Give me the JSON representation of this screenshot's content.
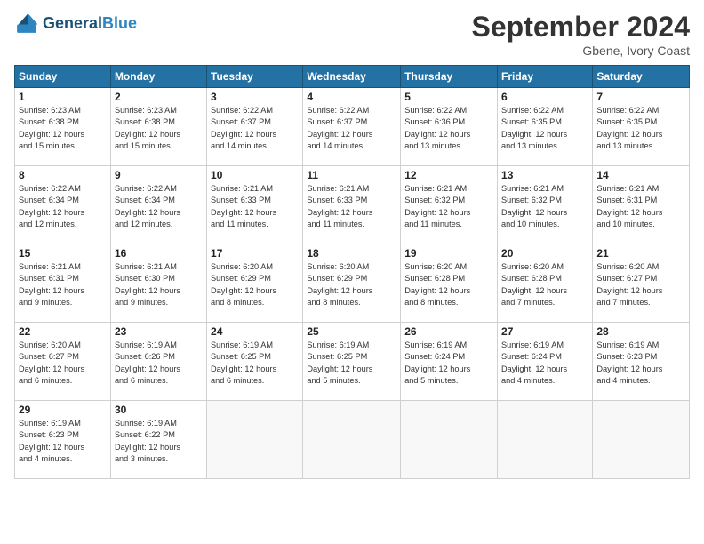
{
  "header": {
    "logo_general": "General",
    "logo_blue": "Blue",
    "month_title": "September 2024",
    "location": "Gbene, Ivory Coast"
  },
  "weekdays": [
    "Sunday",
    "Monday",
    "Tuesday",
    "Wednesday",
    "Thursday",
    "Friday",
    "Saturday"
  ],
  "weeks": [
    [
      {
        "day": "1",
        "info": "Sunrise: 6:23 AM\nSunset: 6:38 PM\nDaylight: 12 hours\nand 15 minutes."
      },
      {
        "day": "2",
        "info": "Sunrise: 6:23 AM\nSunset: 6:38 PM\nDaylight: 12 hours\nand 15 minutes."
      },
      {
        "day": "3",
        "info": "Sunrise: 6:22 AM\nSunset: 6:37 PM\nDaylight: 12 hours\nand 14 minutes."
      },
      {
        "day": "4",
        "info": "Sunrise: 6:22 AM\nSunset: 6:37 PM\nDaylight: 12 hours\nand 14 minutes."
      },
      {
        "day": "5",
        "info": "Sunrise: 6:22 AM\nSunset: 6:36 PM\nDaylight: 12 hours\nand 13 minutes."
      },
      {
        "day": "6",
        "info": "Sunrise: 6:22 AM\nSunset: 6:35 PM\nDaylight: 12 hours\nand 13 minutes."
      },
      {
        "day": "7",
        "info": "Sunrise: 6:22 AM\nSunset: 6:35 PM\nDaylight: 12 hours\nand 13 minutes."
      }
    ],
    [
      {
        "day": "8",
        "info": "Sunrise: 6:22 AM\nSunset: 6:34 PM\nDaylight: 12 hours\nand 12 minutes."
      },
      {
        "day": "9",
        "info": "Sunrise: 6:22 AM\nSunset: 6:34 PM\nDaylight: 12 hours\nand 12 minutes."
      },
      {
        "day": "10",
        "info": "Sunrise: 6:21 AM\nSunset: 6:33 PM\nDaylight: 12 hours\nand 11 minutes."
      },
      {
        "day": "11",
        "info": "Sunrise: 6:21 AM\nSunset: 6:33 PM\nDaylight: 12 hours\nand 11 minutes."
      },
      {
        "day": "12",
        "info": "Sunrise: 6:21 AM\nSunset: 6:32 PM\nDaylight: 12 hours\nand 11 minutes."
      },
      {
        "day": "13",
        "info": "Sunrise: 6:21 AM\nSunset: 6:32 PM\nDaylight: 12 hours\nand 10 minutes."
      },
      {
        "day": "14",
        "info": "Sunrise: 6:21 AM\nSunset: 6:31 PM\nDaylight: 12 hours\nand 10 minutes."
      }
    ],
    [
      {
        "day": "15",
        "info": "Sunrise: 6:21 AM\nSunset: 6:31 PM\nDaylight: 12 hours\nand 9 minutes."
      },
      {
        "day": "16",
        "info": "Sunrise: 6:21 AM\nSunset: 6:30 PM\nDaylight: 12 hours\nand 9 minutes."
      },
      {
        "day": "17",
        "info": "Sunrise: 6:20 AM\nSunset: 6:29 PM\nDaylight: 12 hours\nand 8 minutes."
      },
      {
        "day": "18",
        "info": "Sunrise: 6:20 AM\nSunset: 6:29 PM\nDaylight: 12 hours\nand 8 minutes."
      },
      {
        "day": "19",
        "info": "Sunrise: 6:20 AM\nSunset: 6:28 PM\nDaylight: 12 hours\nand 8 minutes."
      },
      {
        "day": "20",
        "info": "Sunrise: 6:20 AM\nSunset: 6:28 PM\nDaylight: 12 hours\nand 7 minutes."
      },
      {
        "day": "21",
        "info": "Sunrise: 6:20 AM\nSunset: 6:27 PM\nDaylight: 12 hours\nand 7 minutes."
      }
    ],
    [
      {
        "day": "22",
        "info": "Sunrise: 6:20 AM\nSunset: 6:27 PM\nDaylight: 12 hours\nand 6 minutes."
      },
      {
        "day": "23",
        "info": "Sunrise: 6:19 AM\nSunset: 6:26 PM\nDaylight: 12 hours\nand 6 minutes."
      },
      {
        "day": "24",
        "info": "Sunrise: 6:19 AM\nSunset: 6:25 PM\nDaylight: 12 hours\nand 6 minutes."
      },
      {
        "day": "25",
        "info": "Sunrise: 6:19 AM\nSunset: 6:25 PM\nDaylight: 12 hours\nand 5 minutes."
      },
      {
        "day": "26",
        "info": "Sunrise: 6:19 AM\nSunset: 6:24 PM\nDaylight: 12 hours\nand 5 minutes."
      },
      {
        "day": "27",
        "info": "Sunrise: 6:19 AM\nSunset: 6:24 PM\nDaylight: 12 hours\nand 4 minutes."
      },
      {
        "day": "28",
        "info": "Sunrise: 6:19 AM\nSunset: 6:23 PM\nDaylight: 12 hours\nand 4 minutes."
      }
    ],
    [
      {
        "day": "29",
        "info": "Sunrise: 6:19 AM\nSunset: 6:23 PM\nDaylight: 12 hours\nand 4 minutes."
      },
      {
        "day": "30",
        "info": "Sunrise: 6:19 AM\nSunset: 6:22 PM\nDaylight: 12 hours\nand 3 minutes."
      },
      {
        "day": "",
        "info": ""
      },
      {
        "day": "",
        "info": ""
      },
      {
        "day": "",
        "info": ""
      },
      {
        "day": "",
        "info": ""
      },
      {
        "day": "",
        "info": ""
      }
    ]
  ]
}
